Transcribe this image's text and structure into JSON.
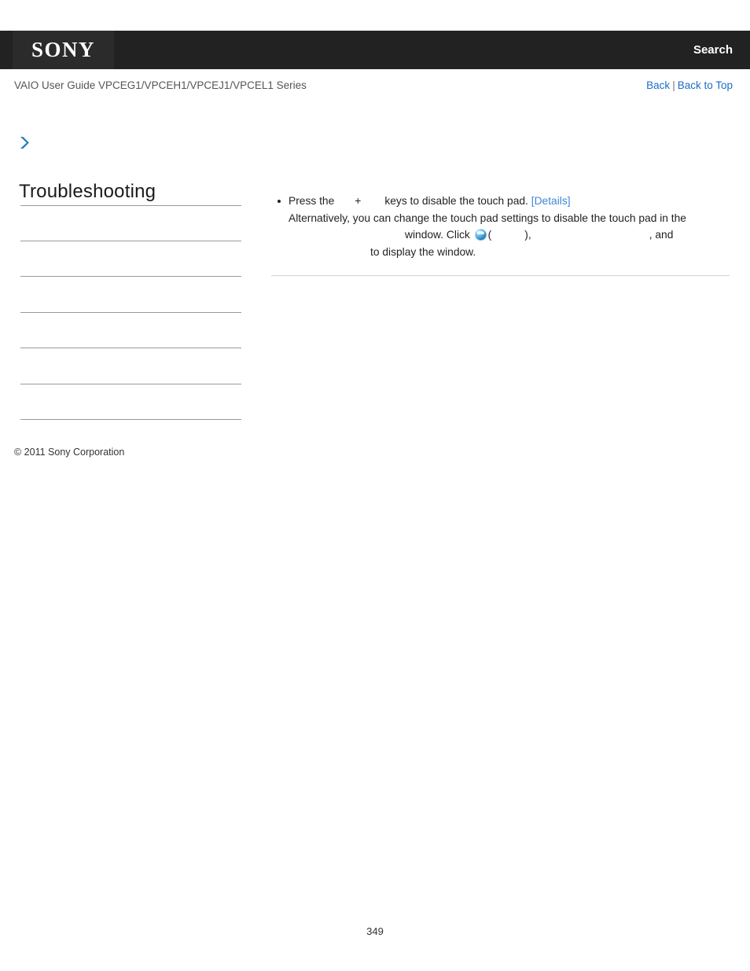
{
  "header": {
    "logo_text": "SONY",
    "search_label": "Search",
    "logo_bg": "#2b2b2b",
    "bar_bg": "#222222"
  },
  "subheader": {
    "guide_title": "VAIO User Guide VPCEG1/VPCEH1/VPCEJ1/VPCEL1 Series",
    "back_label": "Back",
    "separator": "|",
    "back_to_top_label": "Back to Top",
    "link_color": "#1c6ec6"
  },
  "sidebar": {
    "breadcrumb_icon": "chevron-right-icon",
    "section_title": "Troubleshooting",
    "items": [
      {
        "label": ""
      },
      {
        "label": ""
      },
      {
        "label": ""
      },
      {
        "label": ""
      },
      {
        "label": ""
      },
      {
        "label": ""
      }
    ],
    "copyright": "© 2011 Sony Corporation"
  },
  "content": {
    "bullet": {
      "line1_a": "Press the",
      "key_plus": "+",
      "line1_b": "keys to disable the touch pad.",
      "details_label": "[Details]",
      "line2": "Alternatively, you can change the touch pad settings to disable the touch pad in the",
      "line3_a": "window. Click",
      "win_icon": "windows-start-orb-icon",
      "line3_paren_open": "(",
      "line3_paren_close": "),",
      "line3_b": ", and",
      "line4": "to display the window."
    }
  },
  "footer": {
    "page_number": "349"
  }
}
